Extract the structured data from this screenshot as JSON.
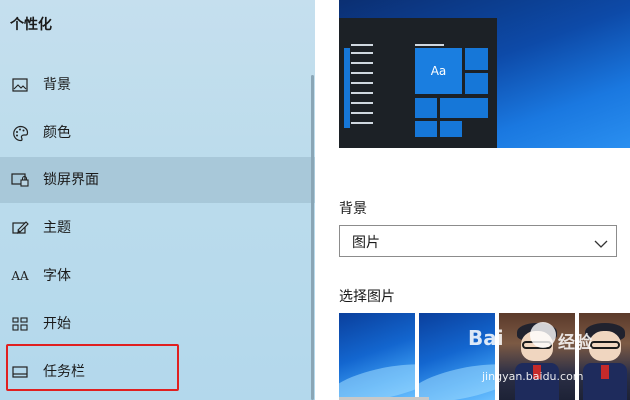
{
  "sidebar": {
    "title": "个性化",
    "items": [
      {
        "label": "背景",
        "icon": "picture-icon"
      },
      {
        "label": "颜色",
        "icon": "palette-icon"
      },
      {
        "label": "锁屏界面",
        "icon": "lock-screen-icon",
        "selected": true
      },
      {
        "label": "主题",
        "icon": "theme-brush-icon"
      },
      {
        "label": "字体",
        "icon": "font-icon"
      },
      {
        "label": "开始",
        "icon": "start-grid-icon"
      },
      {
        "label": "任务栏",
        "icon": "taskbar-icon"
      }
    ],
    "font_icon_text": "AA"
  },
  "preview": {
    "tile_text": "Aa"
  },
  "main": {
    "background_label": "背景",
    "background_value": "图片",
    "choose_picture_label": "选择图片"
  },
  "watermark": {
    "logo": "Bai",
    "brand": "经验",
    "url": "jingyan.baidu.com"
  },
  "colors": {
    "sidebar_bg": "#bcdcec",
    "accent": "#1677d8",
    "highlight_border": "#e02020"
  }
}
